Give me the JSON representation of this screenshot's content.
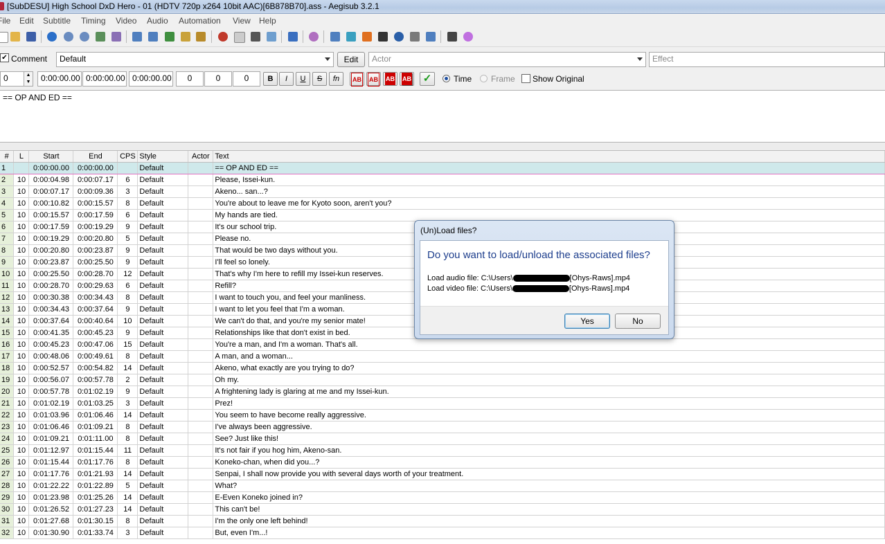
{
  "window": {
    "title": "[SubDESU] High School DxD Hero - 01 (HDTV 720p x264 10bit AAC)[6B878B70].ass - Aegisub 3.2.1"
  },
  "menu": [
    "File",
    "Edit",
    "Subtitle",
    "Timing",
    "Video",
    "Audio",
    "Automation",
    "View",
    "Help"
  ],
  "toolbar_icons": [
    "new-icon",
    "open-icon",
    "save-icon",
    "jump-icon",
    "zoom-in-icon",
    "zoom-out-icon",
    "style-manager-icon",
    "properties-icon",
    "attachments-icon",
    "fonts-icon",
    "translation-icon",
    "find-icon",
    "replace-icon",
    "spell-icon",
    "assistant-icon",
    "shift-times-icon",
    "resample-icon",
    "timing-icon",
    "kanji-icon",
    "styling-icon",
    "select-icon",
    "video-icon",
    "automation-icon",
    "options-icon",
    "tags-icon"
  ],
  "edit_box": {
    "comment_label": "Comment",
    "comment_checked": true,
    "style": "Default",
    "edit_button": "Edit",
    "actor_placeholder": "Actor",
    "effect_placeholder": "Effect",
    "layer": "0",
    "start_time": "0:00:00.00",
    "end_time": "0:00:00.00",
    "duration": "0:00:00.00",
    "margin_l": "0",
    "margin_r": "0",
    "margin_v": "0",
    "bold": "B",
    "italic": "I",
    "underline": "U",
    "strike": "S",
    "font": "fn",
    "color_labels": [
      "AB",
      "AB",
      "AB",
      "AB"
    ],
    "time_label": "Time",
    "frame_label": "Frame",
    "show_original_label": "Show Original",
    "text": "== OP AND ED =="
  },
  "grid": {
    "headers": [
      "#",
      "L",
      "Start",
      "End",
      "CPS",
      "Style",
      "Actor",
      "Text"
    ],
    "rows": [
      [
        "1",
        "",
        "0:00:00.00",
        "0:00:00.00",
        "",
        "Default",
        "",
        "== OP AND ED =="
      ],
      [
        "2",
        "10",
        "0:00:04.98",
        "0:00:07.17",
        "6",
        "Default",
        "",
        "Please, Issei-kun."
      ],
      [
        "3",
        "10",
        "0:00:07.17",
        "0:00:09.36",
        "3",
        "Default",
        "",
        "Akeno... san...?"
      ],
      [
        "4",
        "10",
        "0:00:10.82",
        "0:00:15.57",
        "8",
        "Default",
        "",
        "You're about to leave me for Kyoto soon, aren't you?"
      ],
      [
        "5",
        "10",
        "0:00:15.57",
        "0:00:17.59",
        "6",
        "Default",
        "",
        "My hands are tied."
      ],
      [
        "6",
        "10",
        "0:00:17.59",
        "0:00:19.29",
        "9",
        "Default",
        "",
        "It's our school trip."
      ],
      [
        "7",
        "10",
        "0:00:19.29",
        "0:00:20.80",
        "5",
        "Default",
        "",
        "Please no."
      ],
      [
        "8",
        "10",
        "0:00:20.80",
        "0:00:23.87",
        "9",
        "Default",
        "",
        "That would be two days without you."
      ],
      [
        "9",
        "10",
        "0:00:23.87",
        "0:00:25.50",
        "9",
        "Default",
        "",
        "I'll feel so lonely."
      ],
      [
        "10",
        "10",
        "0:00:25.50",
        "0:00:28.70",
        "12",
        "Default",
        "",
        "That's why I'm here to refill my Issei-kun reserves."
      ],
      [
        "11",
        "10",
        "0:00:28.70",
        "0:00:29.63",
        "6",
        "Default",
        "",
        "Refill?"
      ],
      [
        "12",
        "10",
        "0:00:30.38",
        "0:00:34.43",
        "8",
        "Default",
        "",
        "I want to touch you, and feel your manliness."
      ],
      [
        "13",
        "10",
        "0:00:34.43",
        "0:00:37.64",
        "9",
        "Default",
        "",
        "I want to let you feel that I'm a woman."
      ],
      [
        "14",
        "10",
        "0:00:37.64",
        "0:00:40.64",
        "10",
        "Default",
        "",
        "We can't do that, and you're my senior mate!"
      ],
      [
        "15",
        "10",
        "0:00:41.35",
        "0:00:45.23",
        "9",
        "Default",
        "",
        "Relationships like that don't exist in bed."
      ],
      [
        "16",
        "10",
        "0:00:45.23",
        "0:00:47.06",
        "15",
        "Default",
        "",
        "You're a man, and I'm a woman. That's all."
      ],
      [
        "17",
        "10",
        "0:00:48.06",
        "0:00:49.61",
        "8",
        "Default",
        "",
        "A man, and a woman..."
      ],
      [
        "18",
        "10",
        "0:00:52.57",
        "0:00:54.82",
        "14",
        "Default",
        "",
        "Akeno, what exactly are you trying to do?"
      ],
      [
        "19",
        "10",
        "0:00:56.07",
        "0:00:57.78",
        "2",
        "Default",
        "",
        "Oh my."
      ],
      [
        "20",
        "10",
        "0:00:57.78",
        "0:01:02.19",
        "9",
        "Default",
        "",
        "A frightening lady is glaring at me and my Issei-kun."
      ],
      [
        "21",
        "10",
        "0:01:02.19",
        "0:01:03.25",
        "3",
        "Default",
        "",
        "Prez!"
      ],
      [
        "22",
        "10",
        "0:01:03.96",
        "0:01:06.46",
        "14",
        "Default",
        "",
        "You seem to have become really aggressive."
      ],
      [
        "23",
        "10",
        "0:01:06.46",
        "0:01:09.21",
        "8",
        "Default",
        "",
        "I've always been aggressive."
      ],
      [
        "24",
        "10",
        "0:01:09.21",
        "0:01:11.00",
        "8",
        "Default",
        "",
        "See? Just like this!"
      ],
      [
        "25",
        "10",
        "0:01:12.97",
        "0:01:15.44",
        "11",
        "Default",
        "",
        "It's not fair if you hog him, Akeno-san."
      ],
      [
        "26",
        "10",
        "0:01:15.44",
        "0:01:17.76",
        "8",
        "Default",
        "",
        "Koneko-chan, when did you...?"
      ],
      [
        "27",
        "10",
        "0:01:17.76",
        "0:01:21.93",
        "14",
        "Default",
        "",
        "Senpai, I shall now provide you with several days worth of your treatment."
      ],
      [
        "28",
        "10",
        "0:01:22.22",
        "0:01:22.89",
        "5",
        "Default",
        "",
        "What?"
      ],
      [
        "29",
        "10",
        "0:01:23.98",
        "0:01:25.26",
        "14",
        "Default",
        "",
        "E-Even Koneko joined in?"
      ],
      [
        "30",
        "10",
        "0:01:26.52",
        "0:01:27.23",
        "14",
        "Default",
        "",
        "This can't be!"
      ],
      [
        "31",
        "10",
        "0:01:27.68",
        "0:01:30.15",
        "8",
        "Default",
        "",
        "I'm the only one left behind!"
      ],
      [
        "32",
        "10",
        "0:01:30.90",
        "0:01:33.74",
        "3",
        "Default",
        "",
        "But, even I'm...!"
      ]
    ]
  },
  "dialog": {
    "title": "(Un)Load files?",
    "heading": "Do you want to load/unload the associated files?",
    "audio_prefix": "Load audio file: C:\\Users\\",
    "audio_suffix": "[Ohys-Raws].mp4",
    "video_prefix": "Load video file: C:\\Users\\",
    "video_suffix": "[Ohys-Raws].mp4",
    "yes": "Yes",
    "no": "No"
  },
  "colors": {
    "heading_blue": "#1c3d8c",
    "grid_number_bg": "#e6f0da",
    "active_row_bg": "#cfe9eb"
  }
}
